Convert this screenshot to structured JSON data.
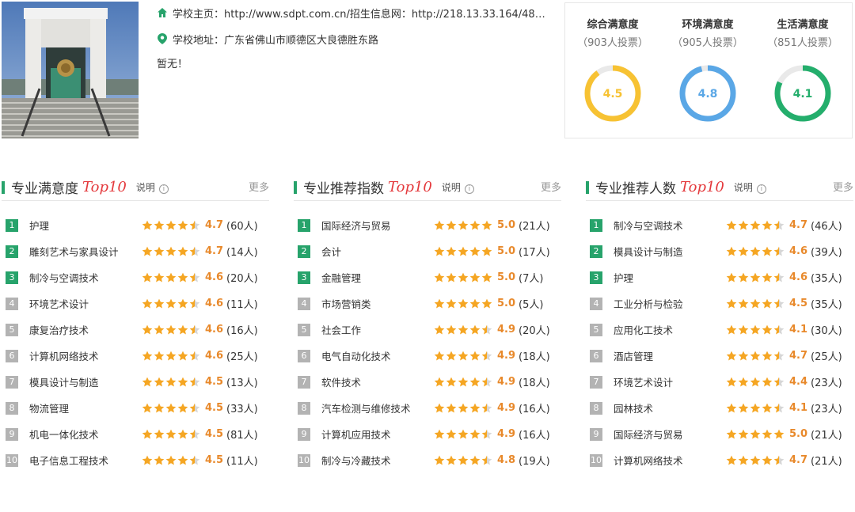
{
  "colors": {
    "accent_green": "#27a36b",
    "rank_gray": "#b3b3b3",
    "score_orange": "#e8892b",
    "star_orange": "#f5a623",
    "top10_red": "#e4393c",
    "ring_overall": "#f7c233",
    "ring_environment": "#5aa7e6",
    "ring_life": "#24ae6c"
  },
  "school": {
    "homepage_label": "学校主页：",
    "homepage_value": "http://www.sdpt.com.cn/招生信息网：http://218.13.33.164/48m/M...",
    "address_label": "学校地址：",
    "address_value": "广东省佛山市顺德区大良德胜东路",
    "description": "暂无！",
    "icons": {
      "homepage": "home-icon",
      "address": "location-pin-icon"
    }
  },
  "satisfaction": [
    {
      "title": "综合满意度",
      "votes": "（903人投票）",
      "score": "4.5",
      "value": 4.5,
      "color": "#f7c233"
    },
    {
      "title": "环境满意度",
      "votes": "（905人投票）",
      "score": "4.8",
      "value": 4.8,
      "color": "#5aa7e6"
    },
    {
      "title": "生活满意度",
      "votes": "（851人投票）",
      "score": "4.1",
      "value": 4.1,
      "color": "#24ae6c"
    }
  ],
  "panels": [
    {
      "title": "专业满意度",
      "top": "Top10",
      "note": "说明",
      "more": "更多",
      "rows": [
        {
          "rank": "1",
          "name": "护理",
          "rating": 4.7,
          "score": "4.7",
          "count": "(60人)"
        },
        {
          "rank": "2",
          "name": "雕刻艺术与家具设计",
          "rating": 4.7,
          "score": "4.7",
          "count": "(14人)"
        },
        {
          "rank": "3",
          "name": "制冷与空调技术",
          "rating": 4.6,
          "score": "4.6",
          "count": "(20人)"
        },
        {
          "rank": "4",
          "name": "环境艺术设计",
          "rating": 4.6,
          "score": "4.6",
          "count": "(11人)"
        },
        {
          "rank": "5",
          "name": "康复治疗技术",
          "rating": 4.6,
          "score": "4.6",
          "count": "(16人)"
        },
        {
          "rank": "6",
          "name": "计算机网络技术",
          "rating": 4.6,
          "score": "4.6",
          "count": "(25人)"
        },
        {
          "rank": "7",
          "name": "模具设计与制造",
          "rating": 4.5,
          "score": "4.5",
          "count": "(13人)"
        },
        {
          "rank": "8",
          "name": "物流管理",
          "rating": 4.5,
          "score": "4.5",
          "count": "(33人)"
        },
        {
          "rank": "9",
          "name": "机电一体化技术",
          "rating": 4.5,
          "score": "4.5",
          "count": "(81人)"
        },
        {
          "rank": "10",
          "name": "电子信息工程技术",
          "rating": 4.5,
          "score": "4.5",
          "count": "(11人)"
        }
      ]
    },
    {
      "title": "专业推荐指数",
      "top": "Top10",
      "note": "说明",
      "more": "更多",
      "rows": [
        {
          "rank": "1",
          "name": "国际经济与贸易",
          "rating": 5.0,
          "score": "5.0",
          "count": "(21人)"
        },
        {
          "rank": "2",
          "name": "会计",
          "rating": 5.0,
          "score": "5.0",
          "count": "(17人)"
        },
        {
          "rank": "3",
          "name": "金融管理",
          "rating": 5.0,
          "score": "5.0",
          "count": "(7人)"
        },
        {
          "rank": "4",
          "name": "市场营销类",
          "rating": 5.0,
          "score": "5.0",
          "count": "(5人)"
        },
        {
          "rank": "5",
          "name": "社会工作",
          "rating": 4.9,
          "score": "4.9",
          "count": "(20人)"
        },
        {
          "rank": "6",
          "name": "电气自动化技术",
          "rating": 4.9,
          "score": "4.9",
          "count": "(18人)"
        },
        {
          "rank": "7",
          "name": "软件技术",
          "rating": 4.9,
          "score": "4.9",
          "count": "(18人)"
        },
        {
          "rank": "8",
          "name": "汽车检测与维修技术",
          "rating": 4.9,
          "score": "4.9",
          "count": "(16人)"
        },
        {
          "rank": "9",
          "name": "计算机应用技术",
          "rating": 4.9,
          "score": "4.9",
          "count": "(16人)"
        },
        {
          "rank": "10",
          "name": "制冷与冷藏技术",
          "rating": 4.8,
          "score": "4.8",
          "count": "(19人)"
        }
      ]
    },
    {
      "title": "专业推荐人数",
      "top": "Top10",
      "note": "说明",
      "more": "更多",
      "rows": [
        {
          "rank": "1",
          "name": "制冷与空调技术",
          "rating": 4.7,
          "score": "4.7",
          "count": "(46人)"
        },
        {
          "rank": "2",
          "name": "模具设计与制造",
          "rating": 4.6,
          "score": "4.6",
          "count": "(39人)"
        },
        {
          "rank": "3",
          "name": "护理",
          "rating": 4.6,
          "score": "4.6",
          "count": "(35人)"
        },
        {
          "rank": "4",
          "name": "工业分析与检验",
          "rating": 4.5,
          "score": "4.5",
          "count": "(35人)"
        },
        {
          "rank": "5",
          "name": "应用化工技术",
          "rating": 4.1,
          "score": "4.1",
          "count": "(30人)"
        },
        {
          "rank": "6",
          "name": "酒店管理",
          "rating": 4.7,
          "score": "4.7",
          "count": "(25人)"
        },
        {
          "rank": "7",
          "name": "环境艺术设计",
          "rating": 4.4,
          "score": "4.4",
          "count": "(23人)"
        },
        {
          "rank": "8",
          "name": "园林技术",
          "rating": 4.1,
          "score": "4.1",
          "count": "(23人)"
        },
        {
          "rank": "9",
          "name": "国际经济与贸易",
          "rating": 5.0,
          "score": "5.0",
          "count": "(21人)"
        },
        {
          "rank": "10",
          "name": "计算机网络技术",
          "rating": 4.7,
          "score": "4.7",
          "count": "(21人)"
        }
      ]
    }
  ]
}
